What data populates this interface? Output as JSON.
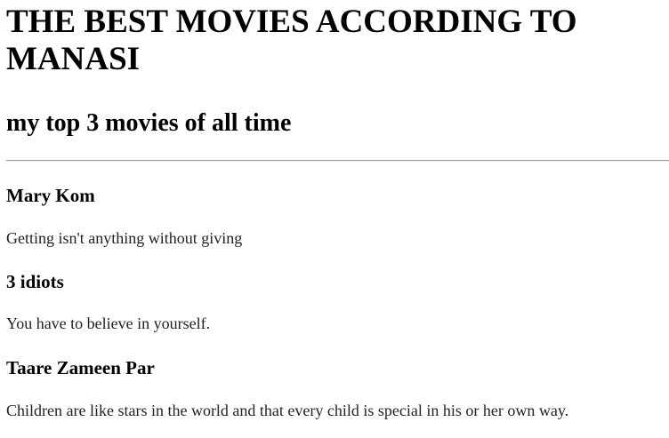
{
  "header": {
    "title": "THE BEST MOVIES ACCORDING TO MANASI",
    "subtitle": "my top 3 movies of all time"
  },
  "movies": [
    {
      "title": "Mary Kom",
      "quote": "Getting isn't anything without giving"
    },
    {
      "title": "3 idiots",
      "quote": "You have to believe in yourself."
    },
    {
      "title": "Taare Zameen Par",
      "quote": "Children are like stars in the world and that every child is special in his or her own way."
    }
  ]
}
